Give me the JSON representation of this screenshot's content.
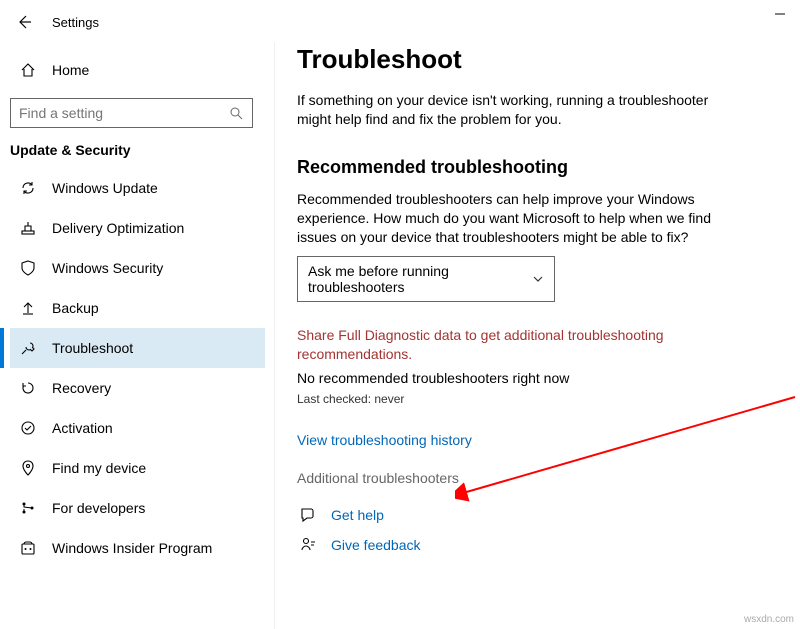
{
  "header": {
    "title": "Settings"
  },
  "sidebar": {
    "home": "Home",
    "search_placeholder": "Find a setting",
    "section": "Update & Security",
    "items": [
      {
        "label": "Windows Update"
      },
      {
        "label": "Delivery Optimization"
      },
      {
        "label": "Windows Security"
      },
      {
        "label": "Backup"
      },
      {
        "label": "Troubleshoot"
      },
      {
        "label": "Recovery"
      },
      {
        "label": "Activation"
      },
      {
        "label": "Find my device"
      },
      {
        "label": "For developers"
      },
      {
        "label": "Windows Insider Program"
      }
    ]
  },
  "main": {
    "title": "Troubleshoot",
    "intro": "If something on your device isn't working, running a troubleshooter might help find and fix the problem for you.",
    "rec_heading": "Recommended troubleshooting",
    "rec_desc": "Recommended troubleshooters can help improve your Windows experience. How much do you want Microsoft to help when we find issues on your device that troubleshooters might be able to fix?",
    "dropdown_value": "Ask me before running troubleshooters",
    "warning": "Share Full Diagnostic data to get additional troubleshooting recommendations.",
    "no_rec": "No recommended troubleshooters right now",
    "last_checked": "Last checked: never",
    "history_link": "View troubleshooting history",
    "additional_link": "Additional troubleshooters",
    "get_help": "Get help",
    "give_feedback": "Give feedback"
  },
  "watermark": "wsxdn.com"
}
